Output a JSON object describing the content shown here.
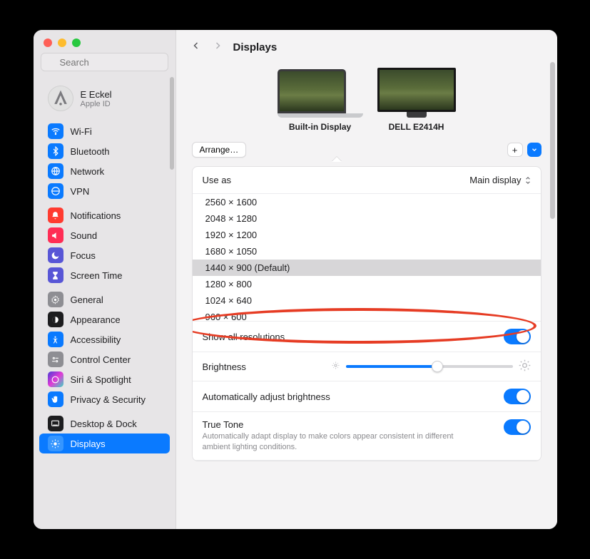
{
  "search": {
    "placeholder": "Search"
  },
  "profile": {
    "name": "E Eckel",
    "sub": "Apple ID"
  },
  "sidebar": {
    "group1": [
      {
        "label": "Wi-Fi",
        "icon": "wifi",
        "bg": "#0a7aff"
      },
      {
        "label": "Bluetooth",
        "icon": "bluetooth",
        "bg": "#0a7aff"
      },
      {
        "label": "Network",
        "icon": "network",
        "bg": "#0a7aff"
      },
      {
        "label": "VPN",
        "icon": "vpn",
        "bg": "#0a7aff"
      }
    ],
    "group2": [
      {
        "label": "Notifications",
        "icon": "bell",
        "bg": "#ff3b30"
      },
      {
        "label": "Sound",
        "icon": "sound",
        "bg": "#ff3b6b"
      },
      {
        "label": "Focus",
        "icon": "moon",
        "bg": "#5856d6"
      },
      {
        "label": "Screen Time",
        "icon": "hourglass",
        "bg": "#5856d6"
      }
    ],
    "group3": [
      {
        "label": "General",
        "icon": "gear",
        "bg": "#8e8e93"
      },
      {
        "label": "Appearance",
        "icon": "appearance",
        "bg": "#1d1d1f"
      },
      {
        "label": "Accessibility",
        "icon": "access",
        "bg": "#0a7aff"
      },
      {
        "label": "Control Center",
        "icon": "cc",
        "bg": "#8e8e93"
      },
      {
        "label": "Siri & Spotlight",
        "icon": "siri",
        "bg": "#1d1d1f"
      },
      {
        "label": "Privacy & Security",
        "icon": "hand",
        "bg": "#0a7aff"
      }
    ],
    "group4": [
      {
        "label": "Desktop & Dock",
        "icon": "dock",
        "bg": "#1d1d1f"
      },
      {
        "label": "Displays",
        "icon": "sun",
        "bg": "#0a7aff",
        "selected": true
      }
    ]
  },
  "header": {
    "title": "Displays"
  },
  "displays": {
    "arrange_label": "Arrange…",
    "items": [
      {
        "label": "Built-in Display",
        "kind": "laptop",
        "selected": true
      },
      {
        "label": "DELL E2414H",
        "kind": "monitor"
      }
    ],
    "plus_label": "+"
  },
  "use_as": {
    "label": "Use as",
    "value": "Main display"
  },
  "resolutions": {
    "items": [
      "2560 × 1600",
      "2048 × 1280",
      "1920 × 1200",
      "1680 × 1050",
      "1440 × 900 (Default)",
      "1280 × 800",
      "1024 × 640",
      "960 × 600"
    ],
    "selected_index": 4
  },
  "show_all": {
    "label": "Show all resolutions",
    "on": true
  },
  "brightness": {
    "label": "Brightness",
    "value": 0.55
  },
  "auto_brightness": {
    "label": "Automatically adjust brightness",
    "on": true
  },
  "true_tone": {
    "label": "True Tone",
    "desc": "Automatically adapt display to make colors appear consistent in different ambient lighting conditions.",
    "on": true
  },
  "colors": {
    "accent": "#0a7aff",
    "highlight": "#e63c24"
  }
}
